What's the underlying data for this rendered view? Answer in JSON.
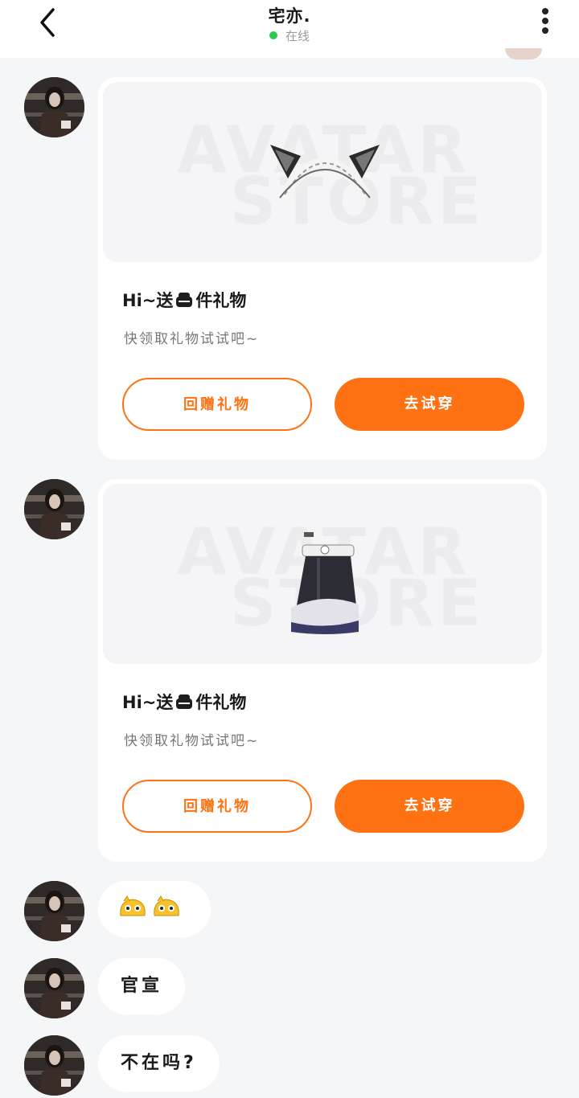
{
  "header": {
    "title": "宅亦.",
    "status": "在线",
    "status_color": "#2dc84d"
  },
  "accent_color": "#ff7214",
  "gift_cards": [
    {
      "item": "cat-ear-headband",
      "watermark_line1": "AVATAR",
      "watermark_line2": "STORE",
      "title_prefix": "Hi~送",
      "title_suffix": "件礼物",
      "subtitle": "快领取礼物试试吧~",
      "return_gift_label": "回赠礼物",
      "try_on_label": "去试穿"
    },
    {
      "item": "socks-boots",
      "watermark_line1": "AVATAR",
      "watermark_line2": "STORE",
      "title_prefix": "Hi~送",
      "title_suffix": "件礼物",
      "subtitle": "快领取礼物试试吧~",
      "return_gift_label": "回赠礼物",
      "try_on_label": "去试穿"
    }
  ],
  "messages": [
    {
      "type": "emoji",
      "icons": [
        "yellow-blob-emoji",
        "yellow-blob-emoji"
      ]
    },
    {
      "type": "text",
      "text": "官宣"
    },
    {
      "type": "text",
      "text": "不在吗?"
    }
  ]
}
